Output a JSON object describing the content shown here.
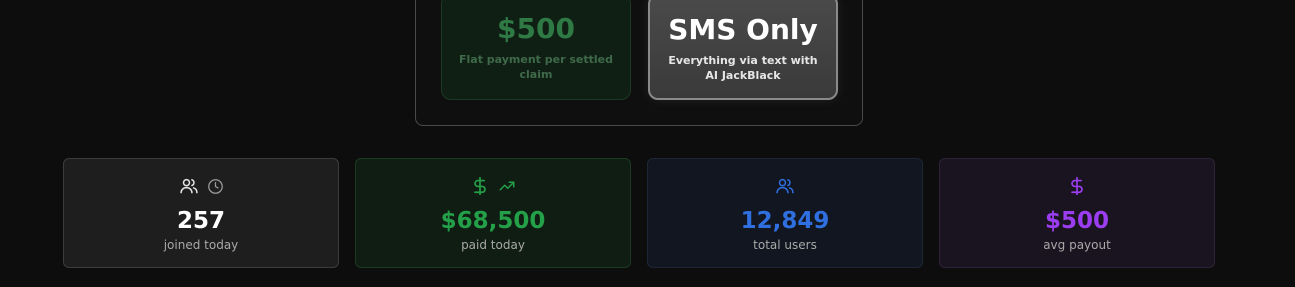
{
  "hero": {
    "price_card": {
      "value": "$500",
      "caption": "Flat payment per settled claim"
    },
    "sms_card": {
      "value": "SMS Only",
      "caption": "Everything via text with AI JackBlack"
    }
  },
  "stats": [
    {
      "value": "257",
      "label": "joined today",
      "icons": [
        "users-icon",
        "clock-icon"
      ],
      "accent": "#ffffff"
    },
    {
      "value": "$68,500",
      "label": "paid today",
      "icons": [
        "dollar-icon",
        "trending-up-icon"
      ],
      "accent": "#24a148"
    },
    {
      "value": "12,849",
      "label": "total users",
      "icons": [
        "users-icon"
      ],
      "accent": "#2f6fe0"
    },
    {
      "value": "$500",
      "label": "avg payout",
      "icons": [
        "dollar-icon"
      ],
      "accent": "#9b3df0"
    }
  ]
}
